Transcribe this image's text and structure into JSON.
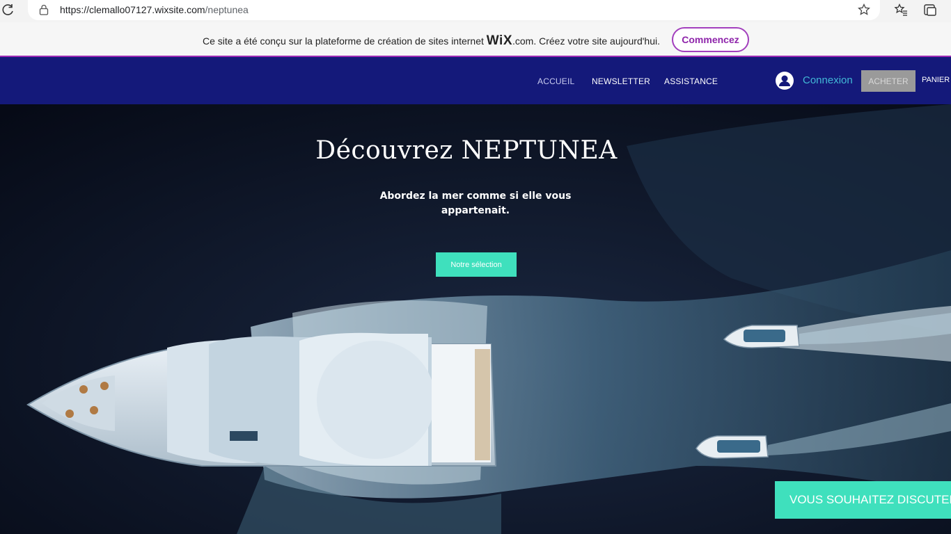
{
  "browser": {
    "url_host": "https://clemallo07127.wixsite.com",
    "url_path": "/neptunea"
  },
  "wix_banner": {
    "text_before": "Ce site a été conçu sur la plateforme de création de sites internet ",
    "logo": "WiX",
    "text_after": ".com. Créez votre site aujourd'hui.",
    "cta_label": "Commencez"
  },
  "header": {
    "nav": [
      "ACCUEIL",
      "NEWSLETTER",
      "ASSISTANCE"
    ],
    "login_label": "Connexion",
    "buy_label": "ACHETER",
    "cart_label": "PANIER"
  },
  "hero": {
    "title": "Découvrez NEPTUNEA",
    "subtitle": "Abordez la mer comme si elle vous appartenait.",
    "cta_label": "Notre sélection",
    "chat_label": "VOUS SOUHAITEZ DISCUTER"
  },
  "colors": {
    "header_bg": "#14197a",
    "accent": "#3fe0bd",
    "wix_purple": "#8e24aa"
  }
}
